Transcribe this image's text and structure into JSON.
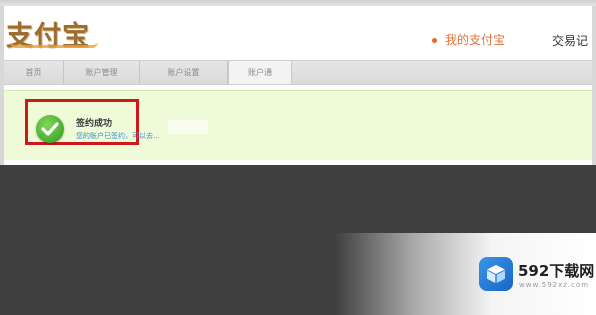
{
  "header": {
    "logo_text": "支付宝",
    "my_alipay": "我的支付宝",
    "trade_link": "交易记"
  },
  "nav": {
    "tabs": [
      {
        "label": "首页"
      },
      {
        "label": "账户管理"
      },
      {
        "label": "账户设置"
      },
      {
        "label": "账户通"
      }
    ]
  },
  "notice": {
    "title": "签约成功",
    "subtitle": "您的账户已签约，可以去..."
  },
  "watermark": {
    "title": "592下载网",
    "url": "www.592xz.com"
  },
  "colors": {
    "success_bg": "#eefad8",
    "highlight": "#d0181b",
    "brand": "#9c6d2f",
    "accent": "#e0733a",
    "link": "#3b8fd0"
  }
}
